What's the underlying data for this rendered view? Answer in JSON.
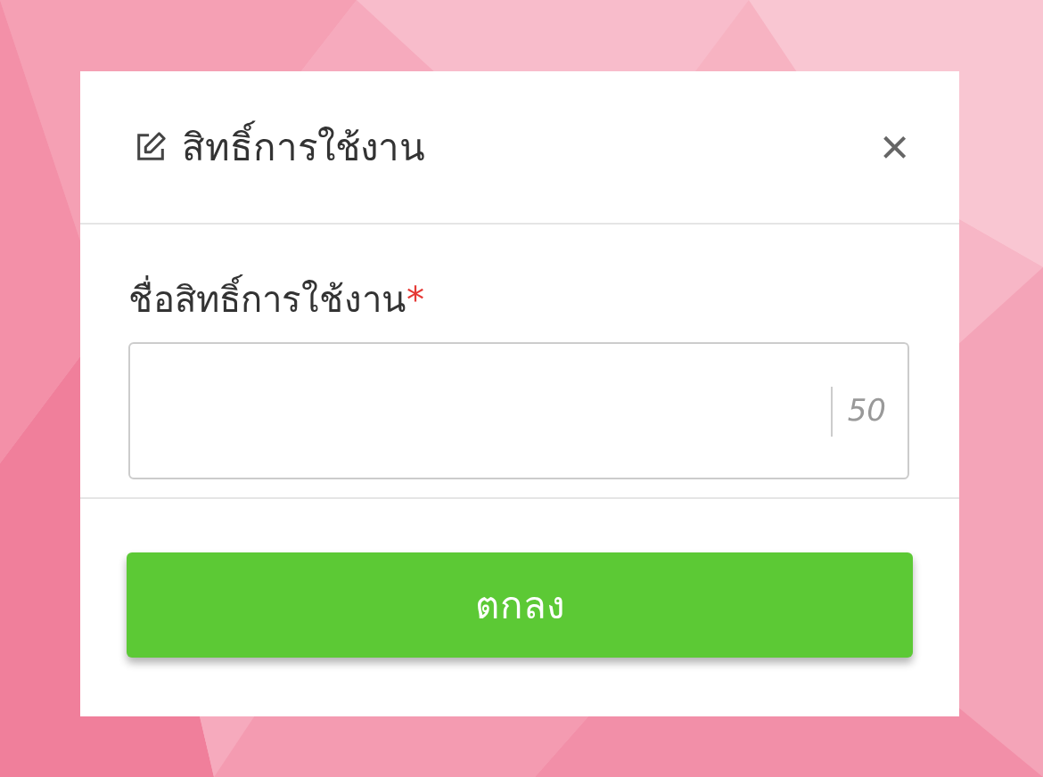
{
  "dialog": {
    "title": "สิทธิ์การใช้งาน",
    "close": "×"
  },
  "field": {
    "label": "ชื่อสิทธิ์การใช้งาน",
    "required": true,
    "required_mark": "*",
    "max_length": "50"
  },
  "button": "ตกลง"
}
